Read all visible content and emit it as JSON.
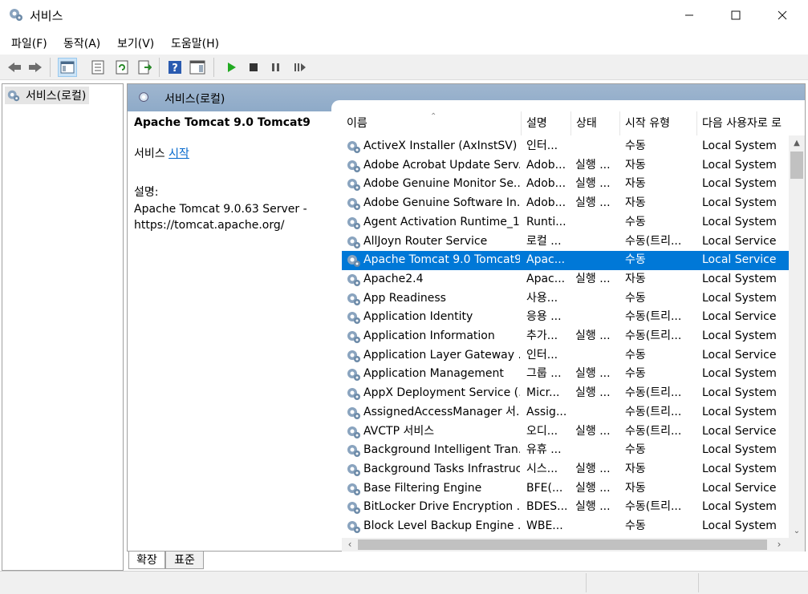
{
  "window": {
    "title": "서비스",
    "icon": "gear-icon"
  },
  "menu": [
    "파일(F)",
    "동작(A)",
    "보기(V)",
    "도움말(H)"
  ],
  "toolbar": {
    "icons": [
      "back-arrow-icon",
      "forward-arrow-icon",
      "show-hide-console-tree-icon",
      "properties-icon",
      "refresh-icon",
      "export-list-icon",
      "help-icon",
      "show-hide-action-pane-icon",
      "play-icon",
      "stop-icon",
      "pause-icon",
      "restart-icon"
    ]
  },
  "tree": {
    "item": "서비스(로컬)"
  },
  "panel": {
    "header": "서비스(로컬)"
  },
  "detail": {
    "service_name": "Apache Tomcat 9.0 Tomcat9",
    "start_prefix": "서비스 ",
    "start_link": "시작",
    "desc_label": "설명:",
    "desc_line1": "Apache Tomcat 9.0.63 Server -",
    "desc_line2": "https://tomcat.apache.org/"
  },
  "list": {
    "columns": [
      "이름",
      "설명",
      "상태",
      "시작 유형",
      "다음 사용자로 로"
    ],
    "rows": [
      {
        "name": "ActiveX Installer (AxInstSV)",
        "desc": "인터...",
        "status": "",
        "startup": "수동",
        "logon": "Local System"
      },
      {
        "name": "Adobe Acrobat Update Serv...",
        "desc": "Adob...",
        "status": "실행 ...",
        "startup": "자동",
        "logon": "Local System"
      },
      {
        "name": "Adobe Genuine Monitor Se...",
        "desc": "Adob...",
        "status": "실행 ...",
        "startup": "자동",
        "logon": "Local System"
      },
      {
        "name": "Adobe Genuine Software In...",
        "desc": "Adob...",
        "status": "실행 ...",
        "startup": "자동",
        "logon": "Local System"
      },
      {
        "name": "Agent Activation Runtime_1...",
        "desc": "Runti...",
        "status": "",
        "startup": "수동",
        "logon": "Local System"
      },
      {
        "name": "AllJoyn Router Service",
        "desc": "로컬 ...",
        "status": "",
        "startup": "수동(트리...",
        "logon": "Local Service"
      },
      {
        "name": "Apache Tomcat 9.0 Tomcat9",
        "desc": "Apac...",
        "status": "",
        "startup": "수동",
        "logon": "Local Service"
      },
      {
        "name": "Apache2.4",
        "desc": "Apac...",
        "status": "실행 ...",
        "startup": "자동",
        "logon": "Local System"
      },
      {
        "name": "App Readiness",
        "desc": "사용...",
        "status": "",
        "startup": "수동",
        "logon": "Local System"
      },
      {
        "name": "Application Identity",
        "desc": "응용 ...",
        "status": "",
        "startup": "수동(트리...",
        "logon": "Local Service"
      },
      {
        "name": "Application Information",
        "desc": "추가...",
        "status": "실행 ...",
        "startup": "수동(트리...",
        "logon": "Local System"
      },
      {
        "name": "Application Layer Gateway ...",
        "desc": "인터...",
        "status": "",
        "startup": "수동",
        "logon": "Local Service"
      },
      {
        "name": "Application Management",
        "desc": "그룹 ...",
        "status": "실행 ...",
        "startup": "수동",
        "logon": "Local System"
      },
      {
        "name": "AppX Deployment Service (...",
        "desc": "Micr...",
        "status": "실행 ...",
        "startup": "수동(트리...",
        "logon": "Local System"
      },
      {
        "name": "AssignedAccessManager 서...",
        "desc": "Assig...",
        "status": "",
        "startup": "수동(트리...",
        "logon": "Local System"
      },
      {
        "name": "AVCTP 서비스",
        "desc": "오디...",
        "status": "실행 ...",
        "startup": "수동(트리...",
        "logon": "Local Service"
      },
      {
        "name": "Background Intelligent Tran...",
        "desc": "유휴 ...",
        "status": "",
        "startup": "수동",
        "logon": "Local System"
      },
      {
        "name": "Background Tasks Infrastruc...",
        "desc": "시스...",
        "status": "실행 ...",
        "startup": "자동",
        "logon": "Local System"
      },
      {
        "name": "Base Filtering Engine",
        "desc": "BFE(...",
        "status": "실행 ...",
        "startup": "자동",
        "logon": "Local Service"
      },
      {
        "name": "BitLocker Drive Encryption ...",
        "desc": "BDES...",
        "status": "실행 ...",
        "startup": "수동(트리...",
        "logon": "Local System"
      },
      {
        "name": "Block Level Backup Engine ...",
        "desc": "WBE...",
        "status": "",
        "startup": "수동",
        "logon": "Local System"
      }
    ],
    "selected_index": 6
  },
  "tabs": [
    "확장",
    "표준"
  ]
}
